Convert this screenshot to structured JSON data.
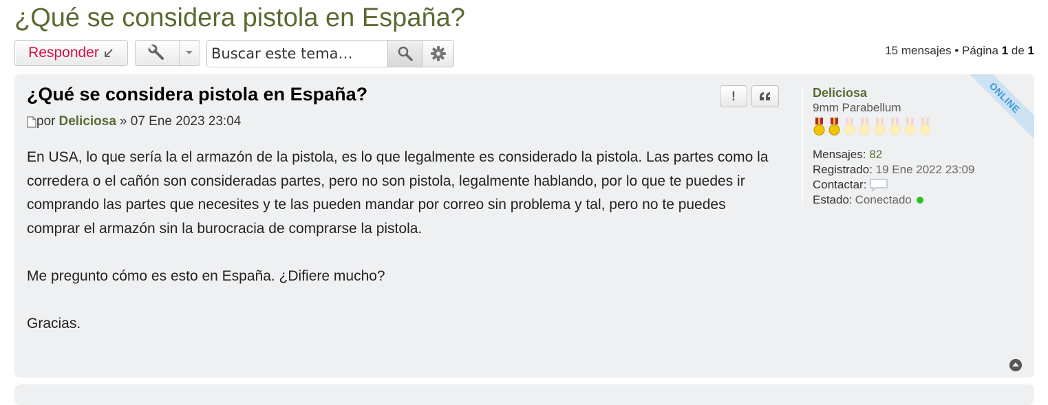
{
  "topic": {
    "title": "¿Qué se considera pistola en España?"
  },
  "action_bar": {
    "reply_label": "Responder",
    "search_placeholder": "Buscar este tema…",
    "pagination": {
      "count_text": "15 mensajes • Página",
      "current": "1",
      "sep": "de",
      "total": "1"
    }
  },
  "post": {
    "title": "¿Qué se considera pistola en España?",
    "by": "por",
    "author": "Deliciosa",
    "date": "» 07 Ene 2023 23:04",
    "paragraphs": [
      "En USA, lo que sería la el armazón de la pistola, es lo que legalmente es considerado la pistola. Las partes como la corredera o el cañón son consideradas partes, pero no son pistola, legalmente hablando, por lo que te puedes ir comprando las partes que necesites y te las pueden mandar por correo sin problema y tal, pero no te puedes comprar el armazón sin la burocracia de comprarse la pistola.",
      "Me pregunto cómo es esto en España. ¿Difiere mucho?",
      "Gracias."
    ]
  },
  "profile": {
    "username": "Deliciosa",
    "rank": "9mm Parabellum",
    "medals_filled": 2,
    "medals_total": 8,
    "posts_label": "Mensajes:",
    "posts_value": "82",
    "joined_label": "Registrado:",
    "joined_value": "19 Ene 2022 23:09",
    "contact_label": "Contactar:",
    "status_label": "Estado:",
    "status_value": "Conectado",
    "online_ribbon": "ONLINE"
  },
  "colors": {
    "accent": "#5a6a32",
    "reply": "#d31141",
    "online": "#2bbf2b"
  }
}
